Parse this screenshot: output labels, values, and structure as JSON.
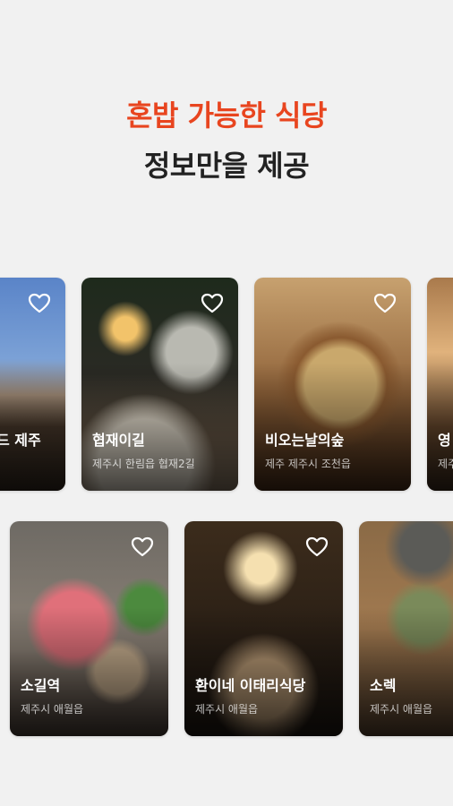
{
  "headline": {
    "accent": "혼밥 가능한 식당",
    "main": "정보만을 제공"
  },
  "colors": {
    "accent": "#e8451f",
    "text_dark": "#222222",
    "background": "#f1f1f1"
  },
  "row1": [
    {
      "name": "드 제주",
      "address": "",
      "icon": "heart-outline-icon"
    },
    {
      "name": "협재이길",
      "address": "제주시 한림읍 협재2길",
      "icon": "heart-outline-icon"
    },
    {
      "name": "비오는날의숲",
      "address": "제주 제주시 조천읍",
      "icon": "heart-outline-icon"
    },
    {
      "name": "영",
      "address": "제주",
      "icon": "heart-outline-icon"
    }
  ],
  "row2": [
    {
      "name": "소길역",
      "address": "제주시 애월읍",
      "icon": "heart-outline-icon"
    },
    {
      "name": "환이네 이태리식당",
      "address": "제주시 애월읍",
      "icon": "heart-outline-icon"
    },
    {
      "name": "소렉",
      "address": "제주시 애월읍",
      "icon": "heart-outline-icon"
    }
  ]
}
